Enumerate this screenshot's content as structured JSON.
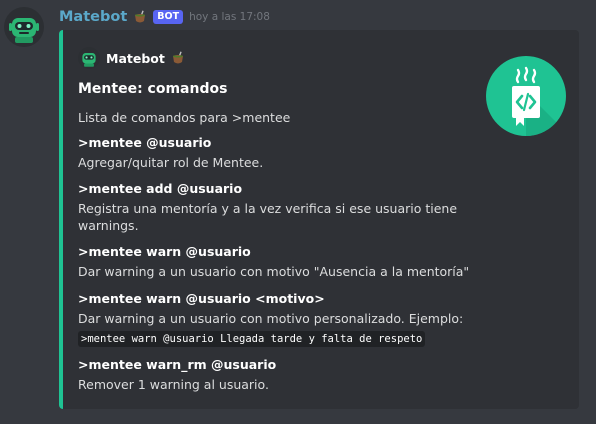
{
  "message": {
    "username": "Matebot",
    "bot_tag": "BOT",
    "timestamp": "hoy a las 17:08"
  },
  "embed": {
    "accent_color": "#1fc393",
    "author": "Matebot",
    "title": "Mentee: comandos",
    "description": "Lista de comandos para >mentee",
    "fields": [
      {
        "name": ">mentee @usuario",
        "value": "Agregar/quitar rol de Mentee."
      },
      {
        "name": ">mentee add @usuario",
        "value": "Registra una mentoría y a la vez verifica si ese usuario tiene warnings."
      },
      {
        "name": ">mentee warn @usuario",
        "value": "Dar warning a un usuario con motivo \"Ausencia a la mentoría\""
      },
      {
        "name": ">mentee warn @usuario <motivo>",
        "value": "Dar warning a un usuario con motivo personalizado. Ejemplo:",
        "code": ">mentee warn @usuario Llegada tarde y falta de respeto"
      },
      {
        "name": ">mentee warn_rm @usuario",
        "value": "Remover 1 warning al usuario."
      }
    ]
  },
  "icons": [
    "robot-avatar-icon",
    "mate-cup-icon",
    "code-document-icon"
  ]
}
